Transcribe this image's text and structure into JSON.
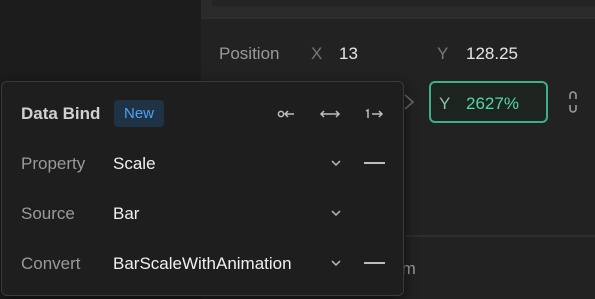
{
  "transform": {
    "position_label": "Position",
    "x_label": "X",
    "x_value": "13",
    "y_label": "Y",
    "y_value": "128.25",
    "scale_y_label": "Y",
    "scale_y_value": "2627%",
    "section_label_partial": "rm"
  },
  "data_bind": {
    "title": "Data Bind",
    "badge": "New",
    "icons": [
      "bind-from-icon",
      "bind-two-way-icon",
      "bind-once-icon"
    ],
    "rows": [
      {
        "label": "Property",
        "value": "Scale"
      },
      {
        "label": "Source",
        "value": "Bar"
      },
      {
        "label": "Convert",
        "value": "BarScaleWithAnimation"
      }
    ]
  },
  "colors": {
    "accent_green": "#53d6a8",
    "accent_blue": "#4da3f0"
  }
}
